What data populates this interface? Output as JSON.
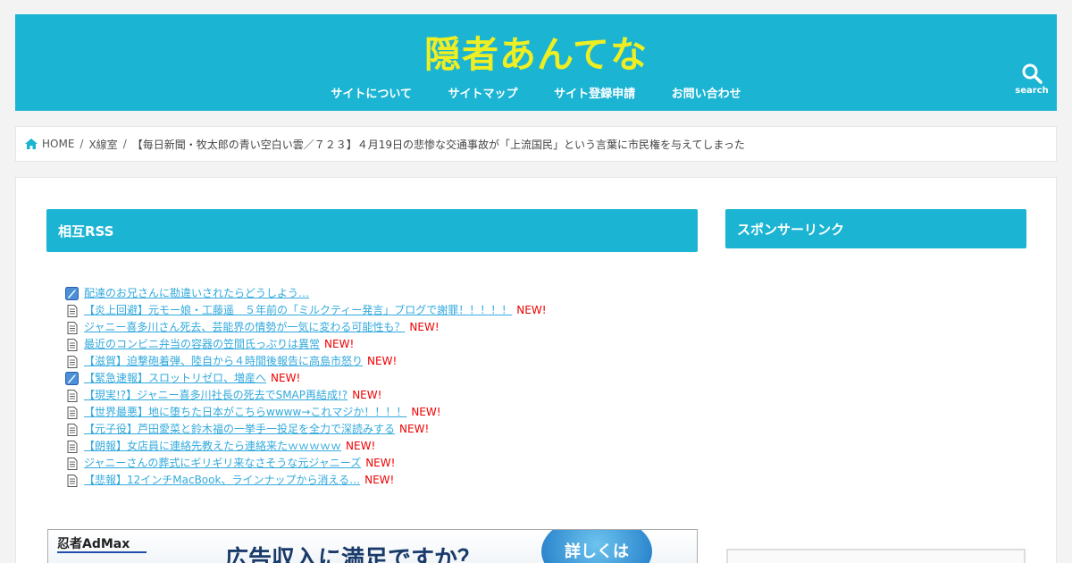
{
  "header": {
    "site_title": "隠者あんてな",
    "nav": [
      "サイトについて",
      "サイトマップ",
      "サイト登録申請",
      "お問い合わせ"
    ],
    "search_label": "search"
  },
  "breadcrumb": {
    "home": "HOME",
    "category": "X線室",
    "current": "【毎日新聞・牧太郎の青い空白い雲／７２３】４月19日の悲惨な交通事故が「上流国民」という言葉に市民権を与えてしまった"
  },
  "main": {
    "widget_title": "相互RSS",
    "new_label": "NEW!",
    "rss_items": [
      {
        "title": "配達のお兄さんに勘違いされたらどうしよう…",
        "icon": "feed-icon",
        "is_new": false
      },
      {
        "title": "【炎上回避】元モー娘・工藤遥　５年前の「ミルクティー発言」ブログで謝罪！！！！！",
        "icon": "page-icon",
        "is_new": true
      },
      {
        "title": "ジャニー喜多川さん死去、芸能界の情勢が一気に変わる可能性も？",
        "icon": "page-icon",
        "is_new": true
      },
      {
        "title": "最近のコンビニ弁当の容器の笠間氏っぷりは異常",
        "icon": "page-icon",
        "is_new": true
      },
      {
        "title": "【滋賀】迫撃砲着弾、陸自から４時間後報告に高島市怒り",
        "icon": "page-icon",
        "is_new": true
      },
      {
        "title": "【緊急速報】スロットリゼロ、増産へ",
        "icon": "feed-icon",
        "is_new": true
      },
      {
        "title": "【現実!?】ジャニー喜多川社長の死去でSMAP再結成!?",
        "icon": "page-icon",
        "is_new": true
      },
      {
        "title": "【世界最悪】地に堕ちた日本がこちらwwww→これマジか！！！！",
        "icon": "page-icon",
        "is_new": true
      },
      {
        "title": "【元子役】芦田愛菜と鈴木福の一挙手一投足を全力で深読みする",
        "icon": "page-icon",
        "is_new": true
      },
      {
        "title": "【朗報】女店員に連絡先教えたら連絡来たｗｗｗｗｗ",
        "icon": "page-icon",
        "is_new": true
      },
      {
        "title": "ジャニーさんの葬式にギリギリ来なさそうな元ジャニーズ",
        "icon": "page-icon",
        "is_new": true
      },
      {
        "title": "【悲報】12インチMacBook、ラインナップから消える…",
        "icon": "page-icon",
        "is_new": true
      }
    ],
    "ad": {
      "logo": "忍者AdMax",
      "headline": "広告収入に満足ですか？",
      "cta": "詳しくは"
    }
  },
  "sidebar": {
    "widget_title": "スポンサーリンク"
  },
  "colors": {
    "accent": "#1bb4d3",
    "title_yellow": "#eeee22",
    "link": "#33aadd",
    "new": "#ee0000"
  }
}
